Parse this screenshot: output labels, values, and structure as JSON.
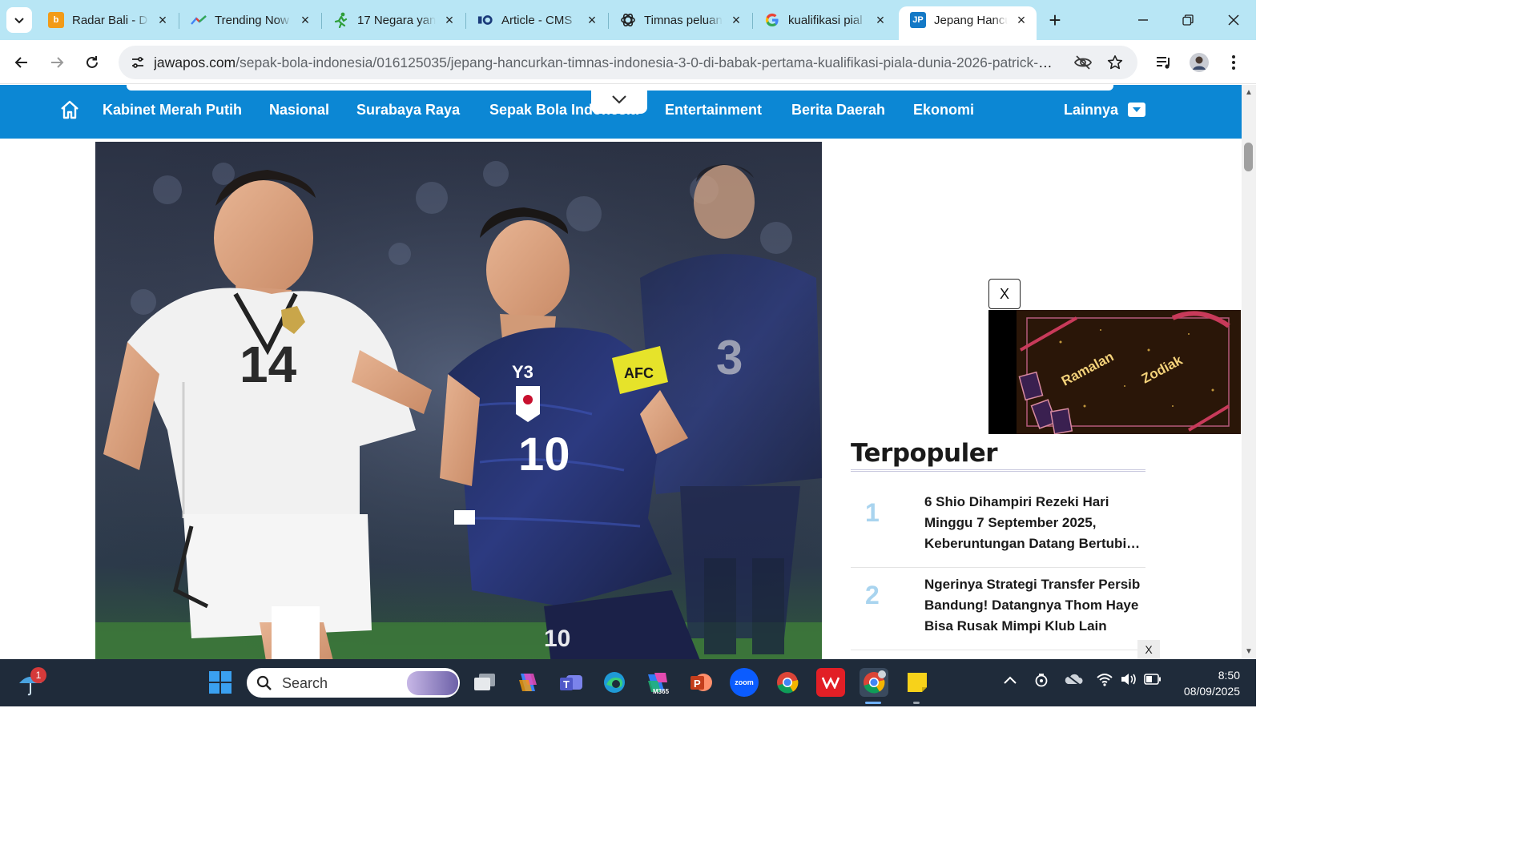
{
  "tabs": [
    {
      "title": "Radar Bali - D",
      "icon": "radar-bali-icon"
    },
    {
      "title": "Trending Now",
      "icon": "google-trends-icon"
    },
    {
      "title": "17 Negara yan",
      "icon": "runner-icon"
    },
    {
      "title": "Article - CMS",
      "icon": "cms-icon"
    },
    {
      "title": "Timnas peluan",
      "icon": "chatgpt-icon"
    },
    {
      "title": "kualifikasi pial",
      "icon": "google-icon"
    },
    {
      "title": "Jepang Hancu",
      "icon": "jawapos-icon",
      "favicon_text": "JP",
      "active": true
    }
  ],
  "address": {
    "host": "jawapos.com",
    "path": "/sepak-bola-indonesia/016125035/jepang-hancurkan-timnas-indonesia-3-0-di-babak-pertama-kualifikasi-piala-dunia-2026-patrick-klu..."
  },
  "nav": {
    "items": [
      "Kabinet Merah Putih",
      "Nasional",
      "Surabaya Raya",
      "Sepak Bola Indonesia",
      "Entertainment",
      "Berita Daerah",
      "Ekonomi"
    ],
    "more": "Lainnya",
    "brand_color": "#0c87d4"
  },
  "hero": {
    "left_shirt_number": "14",
    "center_shirt_sponsor": "Y3",
    "center_shirt_number": "10",
    "captain_band": "AFC",
    "right_shirt_number": "3"
  },
  "ad": {
    "close_label": "X",
    "text_left": "Ramalan",
    "text_right": "Zodiak"
  },
  "popular": {
    "title": "Terpopuler",
    "items": [
      {
        "rank": "1",
        "title": "6 Shio Dihampiri Rezeki Hari Minggu 7 September 2025, Keberuntungan Datang Bertubi-tubi"
      },
      {
        "rank": "2",
        "title": "Ngerinya Strategi Transfer Persib Bandung! Datangnya Thom Haye Bisa Rusak Mimpi Klub Lain"
      }
    ]
  },
  "bottom_ad_close": "X",
  "taskbar": {
    "search_label": "Search",
    "notification_count": "1",
    "time": "8:50",
    "date": "08/09/2025",
    "apps": [
      "windows-start",
      "task-view",
      "copilot",
      "teams",
      "edge",
      "microsoft-365",
      "powerpoint",
      "zoom",
      "chrome",
      "wps-office",
      "chrome-profile",
      "sticky-notes"
    ],
    "zoom_label": "zoom",
    "m365_label": "M365"
  }
}
